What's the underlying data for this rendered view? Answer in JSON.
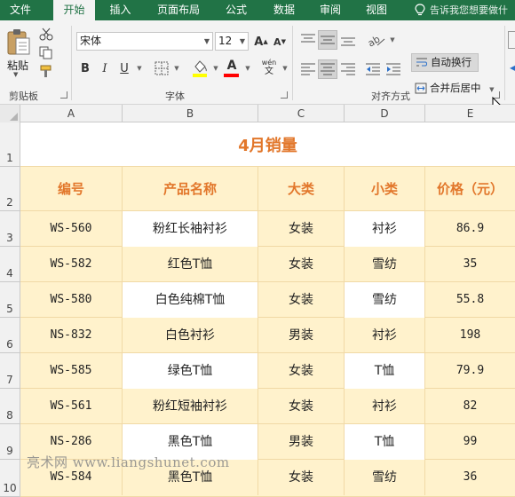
{
  "tabs": [
    "文件",
    "开始",
    "插入",
    "页面布局",
    "公式",
    "数据",
    "审阅",
    "视图"
  ],
  "tell_me": "告诉我您想要做什",
  "ribbon": {
    "clipboard": {
      "paste_label": "粘贴",
      "group_label": "剪贴板"
    },
    "font": {
      "name": "宋体",
      "size": "12",
      "bold": "B",
      "italic": "I",
      "underline": "U",
      "group_label": "字体",
      "fill_color": "#ffff00",
      "font_color": "#ff0000"
    },
    "alignment": {
      "wrap_text": "自动换行",
      "merge_center": "合并后居中",
      "group_label": "对齐方式"
    }
  },
  "columns": [
    "A",
    "B",
    "C",
    "D",
    "E"
  ],
  "rows": [
    "1",
    "2",
    "3",
    "4",
    "5",
    "6",
    "7",
    "8",
    "9",
    "10"
  ],
  "sheet": {
    "title": "4月销量",
    "headers": [
      "编号",
      "产品名称",
      "大类",
      "小类",
      "价格（元）"
    ],
    "data": [
      [
        "WS-560",
        "粉红长袖衬衫",
        "女装",
        "衬衫",
        "86.9"
      ],
      [
        "WS-582",
        "红色T恤",
        "女装",
        "雪纺",
        "35"
      ],
      [
        "WS-580",
        "白色纯棉T恤",
        "女装",
        "雪纺",
        "55.8"
      ],
      [
        "NS-832",
        "白色衬衫",
        "男装",
        "衬衫",
        "198"
      ],
      [
        "WS-585",
        "绿色T恤",
        "女装",
        "T恤",
        "79.9"
      ],
      [
        "WS-561",
        "粉红短袖衬衫",
        "女装",
        "衬衫",
        "82"
      ],
      [
        "NS-286",
        "黑色T恤",
        "男装",
        "T恤",
        "99"
      ],
      [
        "WS-584",
        "黑色T恤",
        "女装",
        "雪纺",
        "36"
      ]
    ]
  },
  "watermark": "亮术网 www.liangshunet.com",
  "colors": {
    "tab_bar": "#217346",
    "title": "#e2772b",
    "fill": "#fff2cc"
  }
}
